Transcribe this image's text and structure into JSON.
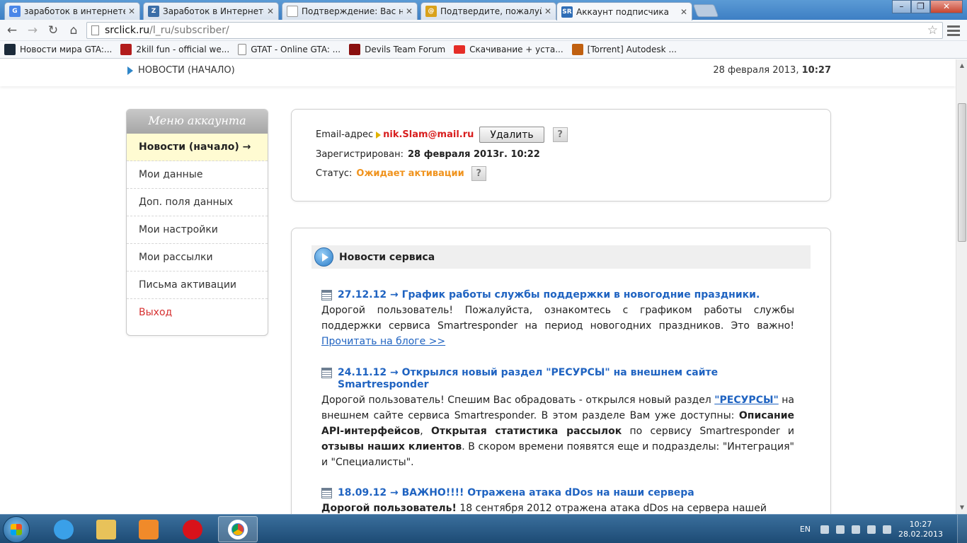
{
  "browser": {
    "tabs": [
      {
        "title": "заработок в интернете - ",
        "favicon": "G",
        "color": "#4a86e8"
      },
      {
        "title": "Заработок в Интернете |",
        "favicon": "Z",
        "color": "#3b6ea8"
      },
      {
        "title": "Подтверждение: Вас нев",
        "favicon": "",
        "color": "#ffffff"
      },
      {
        "title": "Подтвердите, пожалуйст",
        "favicon": "@",
        "color": "#d9a21b"
      },
      {
        "title": "Аккаунт подписчика",
        "favicon": "SR",
        "color": "#2f6db6"
      }
    ],
    "url_host": "srclick.ru",
    "url_path": "/l_ru/subscriber/",
    "bookmarks": [
      {
        "label": "Новости мира GTA:...",
        "color": "#1b2a3a"
      },
      {
        "label": "2kill fun - official we...",
        "color": "#b21c1c"
      },
      {
        "label": "GTAT - Online GTA: ...",
        "color": "#ffffff"
      },
      {
        "label": "Devils Team Forum",
        "color": "#8a1010"
      },
      {
        "label": "Скачивание + уста...",
        "color": "#e52d27"
      },
      {
        "label": "[Torrent] Autodesk ...",
        "color": "#c06010"
      }
    ]
  },
  "page": {
    "breadcrumb": "НОВОСТИ (НАЧАЛО)",
    "date_prefix": "28 февраля 2013,",
    "date_time": "10:27",
    "menu": {
      "title": "Меню аккаунта",
      "items": [
        {
          "label": "Новости (начало) →"
        },
        {
          "label": "Мои данные"
        },
        {
          "label": "Доп. поля данных"
        },
        {
          "label": "Мои настройки"
        },
        {
          "label": "Мои рассылки"
        },
        {
          "label": "Письма активации"
        },
        {
          "label": "Выход"
        }
      ]
    },
    "account": {
      "email_label": "Email-адрес",
      "email_value": "nik.Slam@mail.ru",
      "delete_label": "Удалить",
      "help_label": "?",
      "registered_label": "Зарегистрирован:",
      "registered_value": "28 февраля 2013г. 10:22",
      "status_label": "Статус:",
      "status_value": "Ожидает активации"
    },
    "news": {
      "title": "Новости сервиса",
      "items": [
        {
          "title": "27.12.12 → График работы службы поддержки в новогодние праздники.",
          "text": "Дорогой пользователь! Пожалуйста, ознакомтесь с графиком работы службы поддержки сервиса Smartresponder на период новогодних праздников. Это важно! ",
          "link": "Прочитать на блоге >>"
        },
        {
          "title": "24.11.12 → Открылся новый раздел \"РЕСУРСЫ\" на внешнем сайте Smartresponder",
          "t1": "Дорогой пользователь! Спешим Вас обрадовать - открылся новый раздел ",
          "link": "\"РЕСУРСЫ\"",
          "t2": " на внешнем сайте сервиса Smartresponder. В этом разделе Вам уже доступны: ",
          "b1": "Описание API-интерфейсов",
          "t3": ", ",
          "b2": "Открытая статистика рассылок",
          "t4": " по сервису Smartresponder и ",
          "b3": "отзывы наших клиентов",
          "t5": ". В скором времени появятся еще и подразделы: \"Интеграция\" и \"Специалисты\"."
        },
        {
          "title": "18.09.12 → ВАЖНО!!!! Отражена атака dDos на наши сервера",
          "b1": "Дорогой пользователь!",
          "t1": " 18 сентября 2012 отражена атака dDos на сервера нашей"
        }
      ]
    }
  },
  "taskbar": {
    "apps": [
      {
        "name": "internet-explorer",
        "color": "#3aa0e8"
      },
      {
        "name": "file-explorer",
        "color": "#e8c25a"
      },
      {
        "name": "media-player",
        "color": "#f08a2a"
      },
      {
        "name": "opera",
        "color": "#d8121a"
      },
      {
        "name": "chrome",
        "color": "#4caf50"
      }
    ],
    "lang": "EN",
    "time": "10:27",
    "date": "28.02.2013"
  }
}
